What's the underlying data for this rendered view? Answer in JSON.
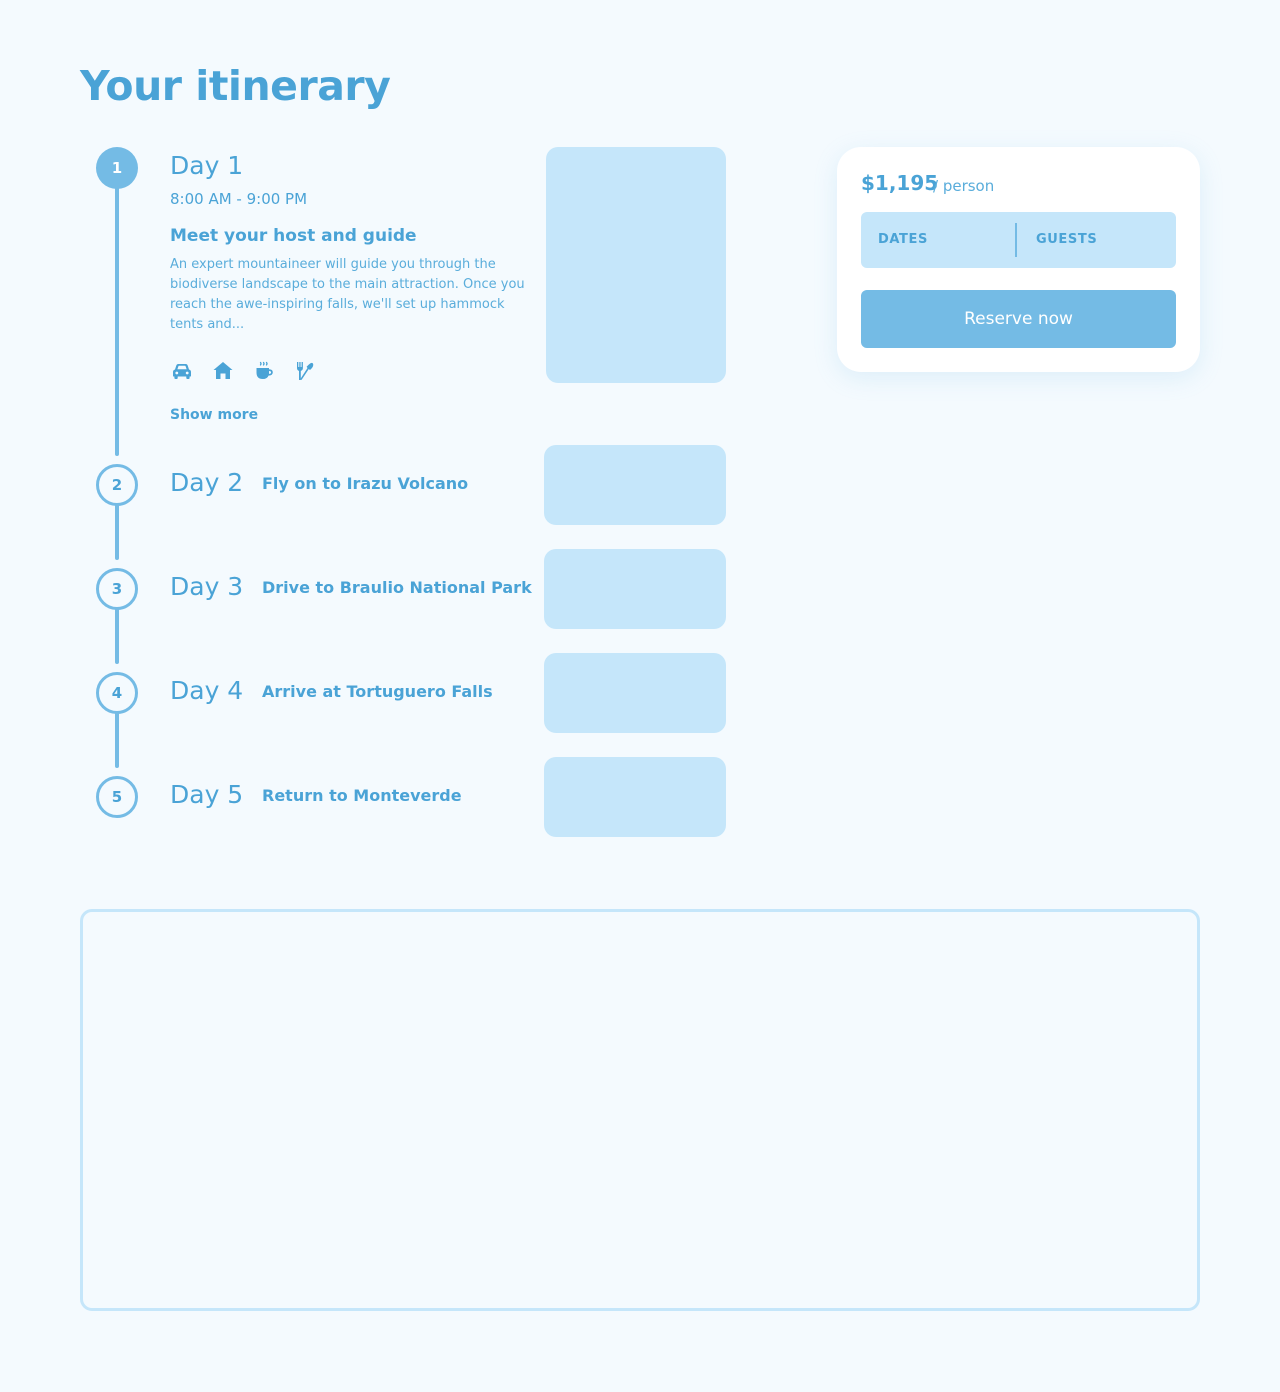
{
  "page": {
    "title": "Your itinerary"
  },
  "colors": {
    "accent": "#74bbe5",
    "text": "#4aa3d6",
    "placeholder": "#c5e6fa",
    "background": "#f4fafe"
  },
  "itinerary": {
    "days": [
      {
        "number": "1",
        "title": "Day 1",
        "time": "8:00 AM - 9:00 PM",
        "heading": "Meet your host and guide",
        "description": "An expert mountaineer will guide you through the biodiverse landscape to the main attraction. Once you reach the awe-inspiring falls, we'll set up hammock tents and...",
        "amenities": [
          "car-icon",
          "house-icon",
          "coffee-icon",
          "dining-icon"
        ],
        "show_more": "Show more"
      },
      {
        "number": "2",
        "title": "Day 2",
        "subtitle": "Fly on to Irazu Volcano"
      },
      {
        "number": "3",
        "title": "Day 3",
        "subtitle": "Drive to Braulio National Park"
      },
      {
        "number": "4",
        "title": "Day 4",
        "subtitle": "Arrive at Tortuguero Falls"
      },
      {
        "number": "5",
        "title": "Day 5",
        "subtitle": "Return to Monteverde"
      }
    ]
  },
  "booking": {
    "price": "$1,195",
    "unit": "/ person",
    "dates_label": "DATES",
    "guests_label": "GUESTS",
    "reserve_label": "Reserve now"
  }
}
